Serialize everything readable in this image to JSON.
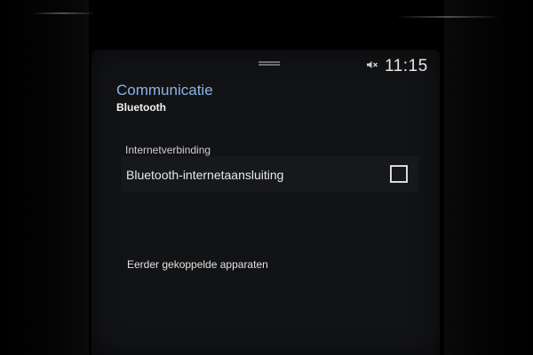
{
  "status_bar": {
    "time": "11:15",
    "mute_icon": "speaker-muted-icon"
  },
  "header": {
    "title": "Communicatie",
    "subtitle": "Bluetooth"
  },
  "sections": {
    "internet": {
      "label": "Internetverbinding",
      "setting_label": "Bluetooth-internetaansluiting",
      "checked": false
    },
    "paired": {
      "label": "Eerder gekoppelde apparaten"
    }
  },
  "colors": {
    "title_accent": "#8ab4e8",
    "background": "#121315"
  }
}
